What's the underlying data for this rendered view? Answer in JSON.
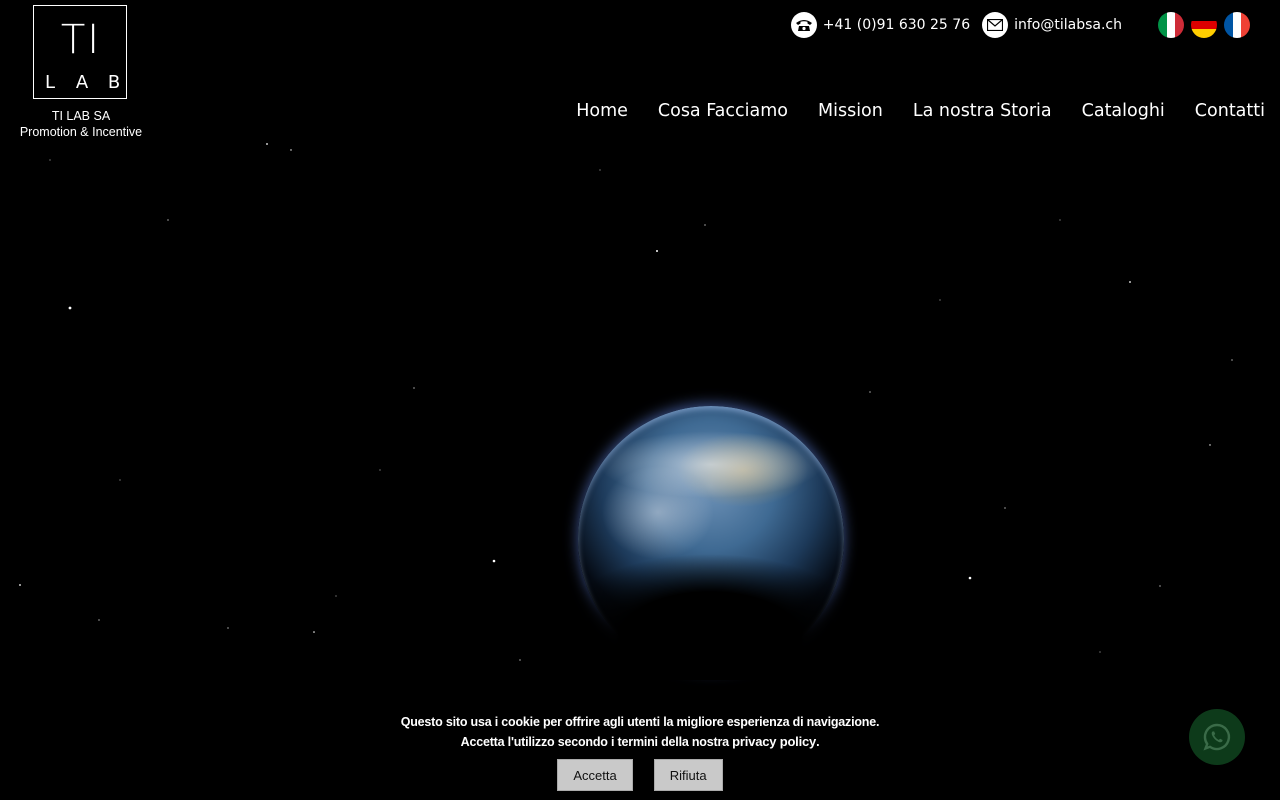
{
  "logo": {
    "line1": "TI",
    "line2": [
      "L",
      "A",
      "B"
    ],
    "company_name": "TI LAB SA",
    "tagline": "Promotion & Incentive"
  },
  "contact": {
    "phone": "+41 (0)91 630 25 76",
    "phone_icon": "phone-icon",
    "email": "info@tilabsa.ch",
    "email_icon": "mail-icon"
  },
  "languages": [
    {
      "code": "it",
      "icon": "flag-italy-icon",
      "colors": [
        "#009246",
        "#ffffff",
        "#ce2b37"
      ]
    },
    {
      "code": "de",
      "icon": "flag-germany-icon",
      "colors": [
        "#000000",
        "#dd0000",
        "#ffce00"
      ]
    },
    {
      "code": "fr",
      "icon": "flag-france-icon",
      "colors": [
        "#0055a4",
        "#ffffff",
        "#ef4135"
      ]
    }
  ],
  "nav": {
    "items": [
      "Home",
      "Cosa Facciamo",
      "Mission",
      "La nostra Storia",
      "Cataloghi",
      "Contatti"
    ]
  },
  "cookie": {
    "line1": "Questo sito usa i cookie per offrire agli utenti la migliore esperienza di navigazione.",
    "line2_prefix": "Accetta l'utilizzo secondo i termini della nostra ",
    "policy_link": "privacy policy",
    "line2_suffix": ".",
    "accept_label": "Accetta",
    "reject_label": "Rifiuta"
  },
  "whatsapp": {
    "icon": "whatsapp-icon",
    "color": "#0d3a1a"
  },
  "colors": {
    "background": "#000000",
    "text": "#ffffff",
    "button_bg": "#c9c9c9"
  }
}
